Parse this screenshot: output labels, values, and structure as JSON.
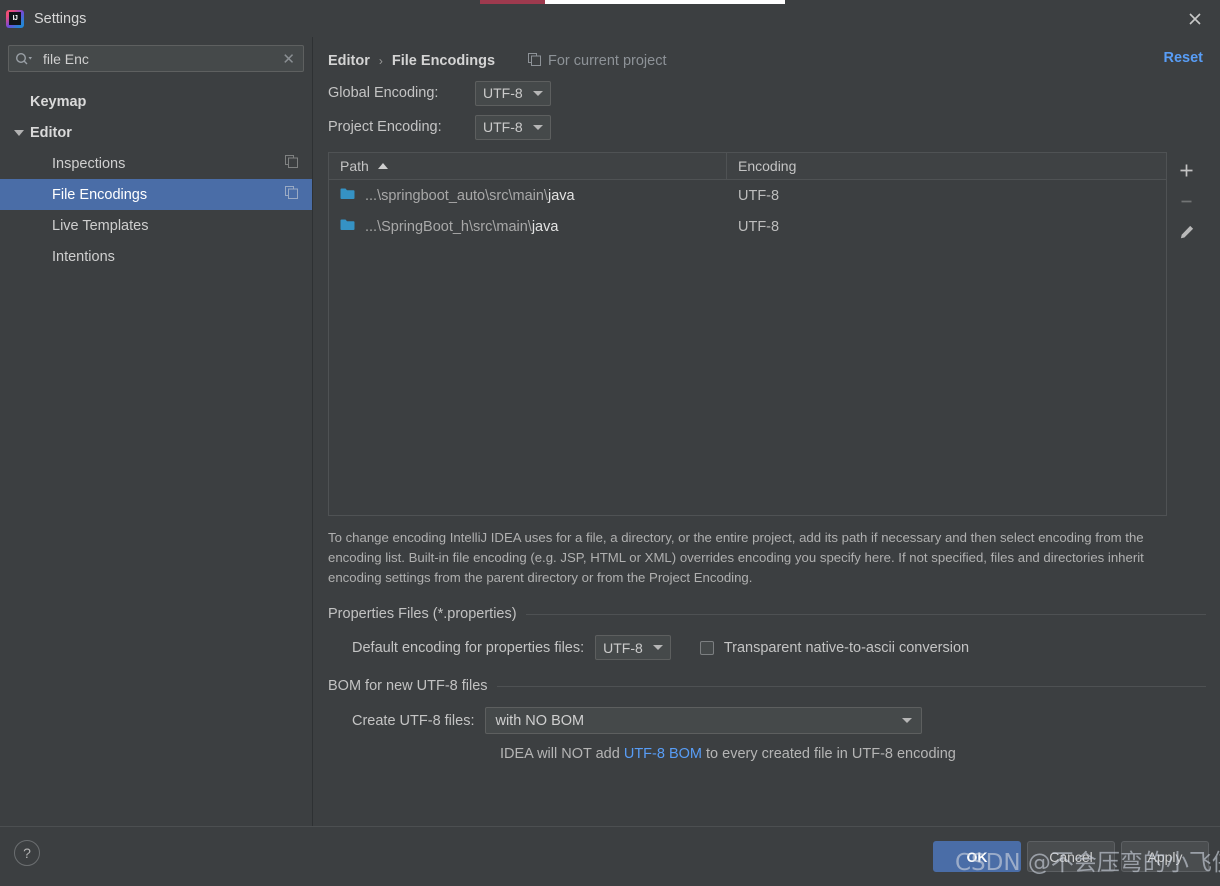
{
  "window": {
    "title": "Settings",
    "logo_icon": "intellij-idea-logo",
    "close_icon": "close-icon"
  },
  "sidebar": {
    "search": {
      "value": "file Enc",
      "placeholder": "",
      "search_icon": "search-icon",
      "clear_icon": "clear-icon"
    },
    "items": [
      {
        "label": "Keymap",
        "level": 0,
        "selected": false,
        "expandable": false,
        "has_copy_icon": false
      },
      {
        "label": "Editor",
        "level": 0,
        "selected": false,
        "expandable": true,
        "expanded": true,
        "has_copy_icon": false
      },
      {
        "label": "Inspections",
        "level": 1,
        "selected": false,
        "expandable": false,
        "has_copy_icon": true
      },
      {
        "label": "File Encodings",
        "level": 1,
        "selected": true,
        "expandable": false,
        "has_copy_icon": true
      },
      {
        "label": "Live Templates",
        "level": 1,
        "selected": false,
        "expandable": false,
        "has_copy_icon": false
      },
      {
        "label": "Intentions",
        "level": 1,
        "selected": false,
        "expandable": false,
        "has_copy_icon": false
      }
    ]
  },
  "main": {
    "breadcrumb": {
      "parent": "Editor",
      "separator": "›",
      "current": "File Encodings"
    },
    "for_current_project": {
      "label": "For current project",
      "icon": "copy-config-icon"
    },
    "reset_label": "Reset",
    "global_encoding": {
      "label": "Global Encoding:",
      "value": "UTF-8"
    },
    "project_encoding": {
      "label": "Project Encoding:",
      "value": "UTF-8"
    },
    "table": {
      "columns": [
        "Path",
        "Encoding"
      ],
      "sort_column": "Path",
      "sort_direction": "asc",
      "rows": [
        {
          "path_prefix": "...\\springboot_auto\\src\\main\\",
          "path_leaf": "java",
          "encoding": "UTF-8",
          "icon": "folder-icon"
        },
        {
          "path_prefix": "...\\SpringBoot_h\\src\\main\\",
          "path_leaf": "java",
          "encoding": "UTF-8",
          "icon": "folder-icon"
        }
      ],
      "tools": [
        {
          "name": "add-row-button",
          "icon": "plus-icon",
          "enabled": true
        },
        {
          "name": "remove-row-button",
          "icon": "minus-icon",
          "enabled": false
        },
        {
          "name": "edit-row-button",
          "icon": "pencil-icon",
          "enabled": true
        }
      ]
    },
    "description": "To change encoding IntelliJ IDEA uses for a file, a directory, or the entire project, add its path if necessary and then select encoding from the encoding list. Built-in file encoding (e.g. JSP, HTML or XML) overrides encoding you specify here. If not specified, files and directories inherit encoding settings from the parent directory or from the Project Encoding.",
    "properties_group": {
      "title": "Properties Files (*.properties)",
      "default_encoding_label": "Default encoding for properties files:",
      "default_encoding_value": "UTF-8",
      "transparent_label": "Transparent native-to-ascii conversion",
      "transparent_checked": false
    },
    "bom_group": {
      "title": "BOM for new UTF-8 files",
      "create_label": "Create UTF-8 files:",
      "create_value": "with NO BOM",
      "note_prefix": "IDEA will NOT add ",
      "note_link": "UTF-8 BOM",
      "note_suffix": " to every created file in UTF-8 encoding"
    }
  },
  "footer": {
    "help_label": "?",
    "ok_label": "OK",
    "cancel_label": "Cancel",
    "apply_label": "Apply"
  },
  "watermark": {
    "text": "CSDN @不会压弯的小飞侠"
  },
  "colors": {
    "background": "#3c3f41",
    "selection": "#4a6da7",
    "link": "#589df6",
    "folder": "#3592c4"
  }
}
